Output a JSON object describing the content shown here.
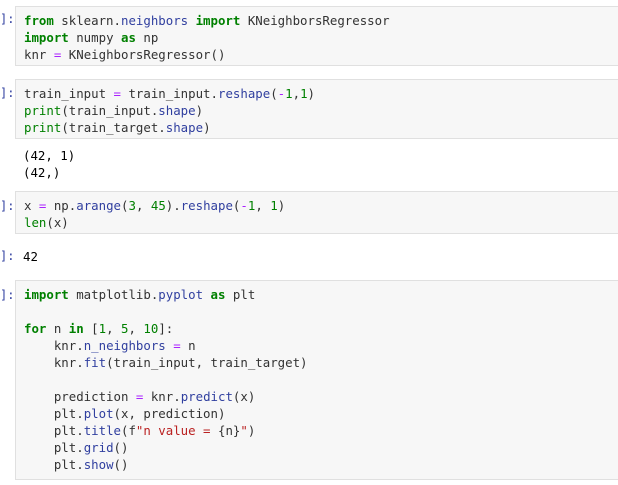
{
  "cells": [
    {
      "prompt": "]:",
      "lines": [
        [
          "from",
          " sklearn.",
          "neighbors",
          " ",
          "import",
          " KNeighborsRegressor"
        ],
        [
          "import",
          " numpy ",
          "as",
          " np"
        ],
        [
          "knr ",
          "=",
          " KNeighborsRegressor()"
        ]
      ]
    },
    {
      "prompt": "]:",
      "lines": [
        "train_input = train_input.reshape(-1,1)",
        "print(train_input.shape)",
        "print(train_target.shape)"
      ],
      "output": [
        "(42, 1)",
        "(42,)"
      ]
    },
    {
      "prompt": "]:",
      "lines": [
        "x = np.arange(3, 45).reshape(-1, 1)",
        "len(x)"
      ],
      "output_prompt": "]:",
      "output": [
        "42"
      ]
    },
    {
      "prompt": "]:",
      "lines": [
        "import matplotlib.pyplot as plt",
        "",
        "for n in [1, 5, 10]:",
        "    knr.n_neighbors = n",
        "    knr.fit(train_input, train_target)",
        "",
        "    prediction = knr.predict(x)",
        "    plt.plot(x, prediction)",
        "    plt.title(f\"n value = {n}\")",
        "    plt.grid()",
        "    plt.show()"
      ]
    }
  ]
}
